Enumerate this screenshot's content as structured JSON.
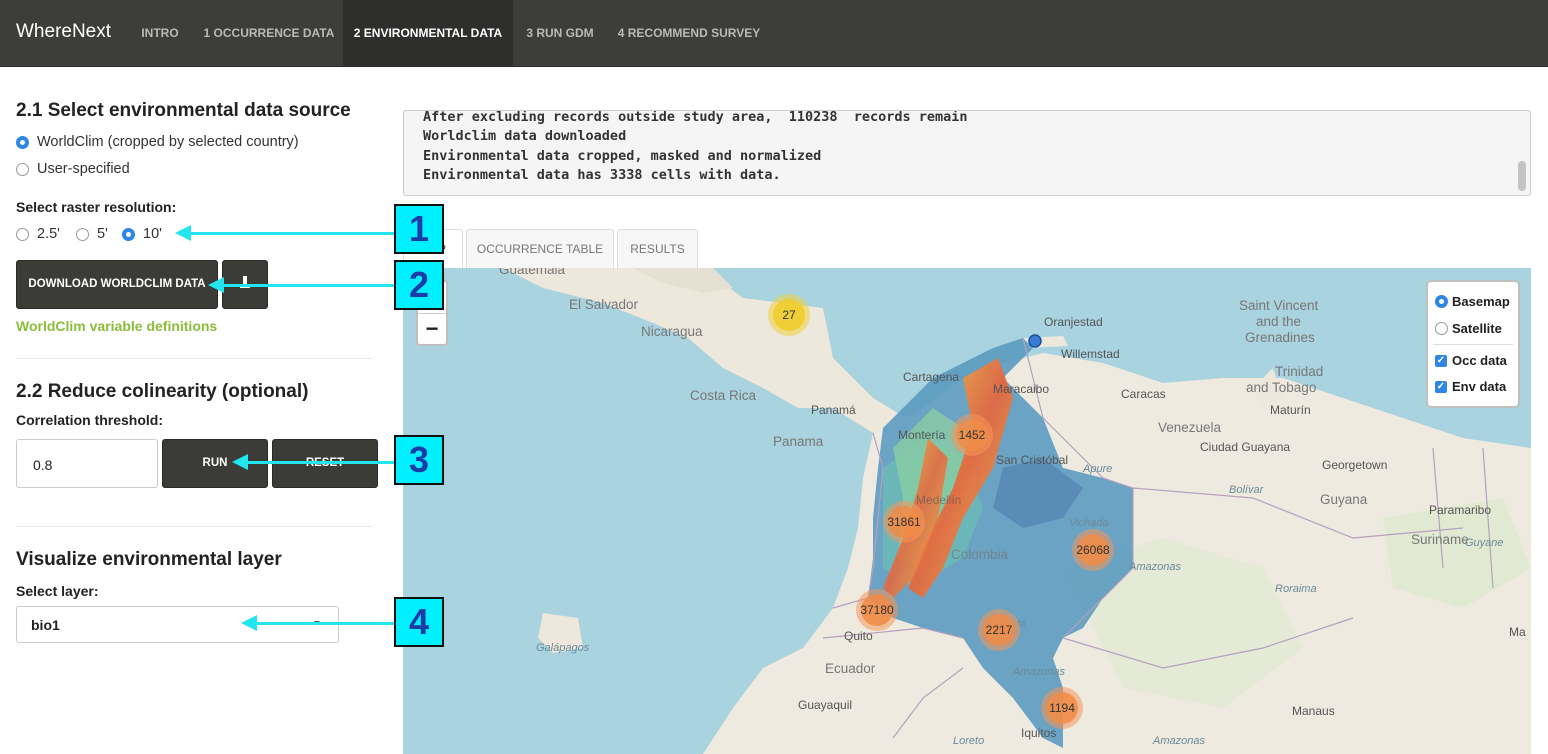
{
  "navbar": {
    "brand": "WhereNext",
    "items": [
      {
        "label": "INTRO"
      },
      {
        "label": "1 OCCURRENCE DATA"
      },
      {
        "label": "2 ENVIRONMENTAL DATA"
      },
      {
        "label": "3 RUN GDM"
      },
      {
        "label": "4 RECOMMEND SURVEY"
      }
    ]
  },
  "sidebar": {
    "section1_title": "2.1 Select environmental data source",
    "source_options": [
      "WorldClim (cropped by selected country)",
      "User-specified"
    ],
    "source_selected": "WorldClim (cropped by selected country)",
    "resolution_label": "Select raster resolution:",
    "resolution_options": [
      "2.5'",
      "5'",
      "10'"
    ],
    "resolution_selected": "10'",
    "download_button": "DOWNLOAD WORLDCLIM DATA",
    "download_icon": "download-icon",
    "definitions_link": "WorldClim variable definitions",
    "section2_title": "2.2 Reduce colinearity (optional)",
    "threshold_label": "Correlation threshold:",
    "threshold_value": "0.8",
    "run_button": "RUN",
    "reset_button": "RESET",
    "section3_title": "Visualize environmental layer",
    "layer_label": "Select layer:",
    "layer_value": "bio1"
  },
  "console": {
    "lines": [
      "After excluding records outside study area,  110238  records remain",
      "Worldclim data downloaded",
      "Environmental data cropped, masked and normalized",
      "Environmental data has 3338 cells with data."
    ]
  },
  "tabs": [
    {
      "label": "MAP"
    },
    {
      "label": "OCCURRENCE TABLE"
    },
    {
      "label": "RESULTS"
    }
  ],
  "map": {
    "zoom_in": "+",
    "zoom_out": "−",
    "layers": {
      "basemap": "Basemap",
      "satellite": "Satellite",
      "occ": "Occ data",
      "env": "Env data",
      "selected_base": "Basemap",
      "occ_checked": true,
      "env_checked": true
    },
    "clusters": [
      "27",
      "1452",
      "31861",
      "26068",
      "37180",
      "2217",
      "1194"
    ],
    "labels": {
      "guatemala": "Guatemala",
      "el_salvador": "El Salvador",
      "nicaragua": "Nicaragua",
      "costa_rica": "Costa Rica",
      "panama_city": "Panamá",
      "panama": "Panama",
      "oranjestad": "Oranjestad",
      "willemstad": "Willemstad",
      "cartagena": "Cartagena",
      "maracaibo": "Maracaibo",
      "caracas": "Caracas",
      "maturin": "Maturín",
      "venezuela": "Venezuela",
      "ciudad_guayana": "Ciudad Guayana",
      "georgetown": "Georgetown",
      "guyana": "Guyana",
      "paramaribo": "Paramaribo",
      "suriname": "Suriname",
      "st_vincent_1": "Saint Vincent",
      "st_vincent_2": "and the",
      "st_vincent_3": "Grenadines",
      "trinidad_1": "Trinidad",
      "trinidad_2": "and Tobago",
      "monteria": "Montería",
      "san_cristobal": "San Cristóbal",
      "medellin": "Medellín",
      "colombia": "Colombia",
      "quito": "Quito",
      "ecuador": "Ecuador",
      "guayaquil": "Guayaquil",
      "iquitos": "Iquitos",
      "manaus": "Manaus",
      "ma": "Ma",
      "galapagos": "Galápagos",
      "apure": "Apure",
      "bolivar": "Bolívar",
      "vichada": "Vichada",
      "amazonas_1": "Amazonas",
      "amazonas_2": "Amazonas",
      "amazonas_3": "Amazonas",
      "roraima": "Roraima",
      "guyane": "Guyane",
      "caqueta": "Caquetá",
      "loreto": "Loreto"
    }
  },
  "callouts": [
    "1",
    "2",
    "3",
    "4"
  ],
  "colors": {
    "navbar": "#3d3d3a",
    "accent_blue": "#2f86e6",
    "link_green": "#8bbd3a",
    "callout_cyan": "#00f0ff",
    "sea": "#a9d3df"
  }
}
